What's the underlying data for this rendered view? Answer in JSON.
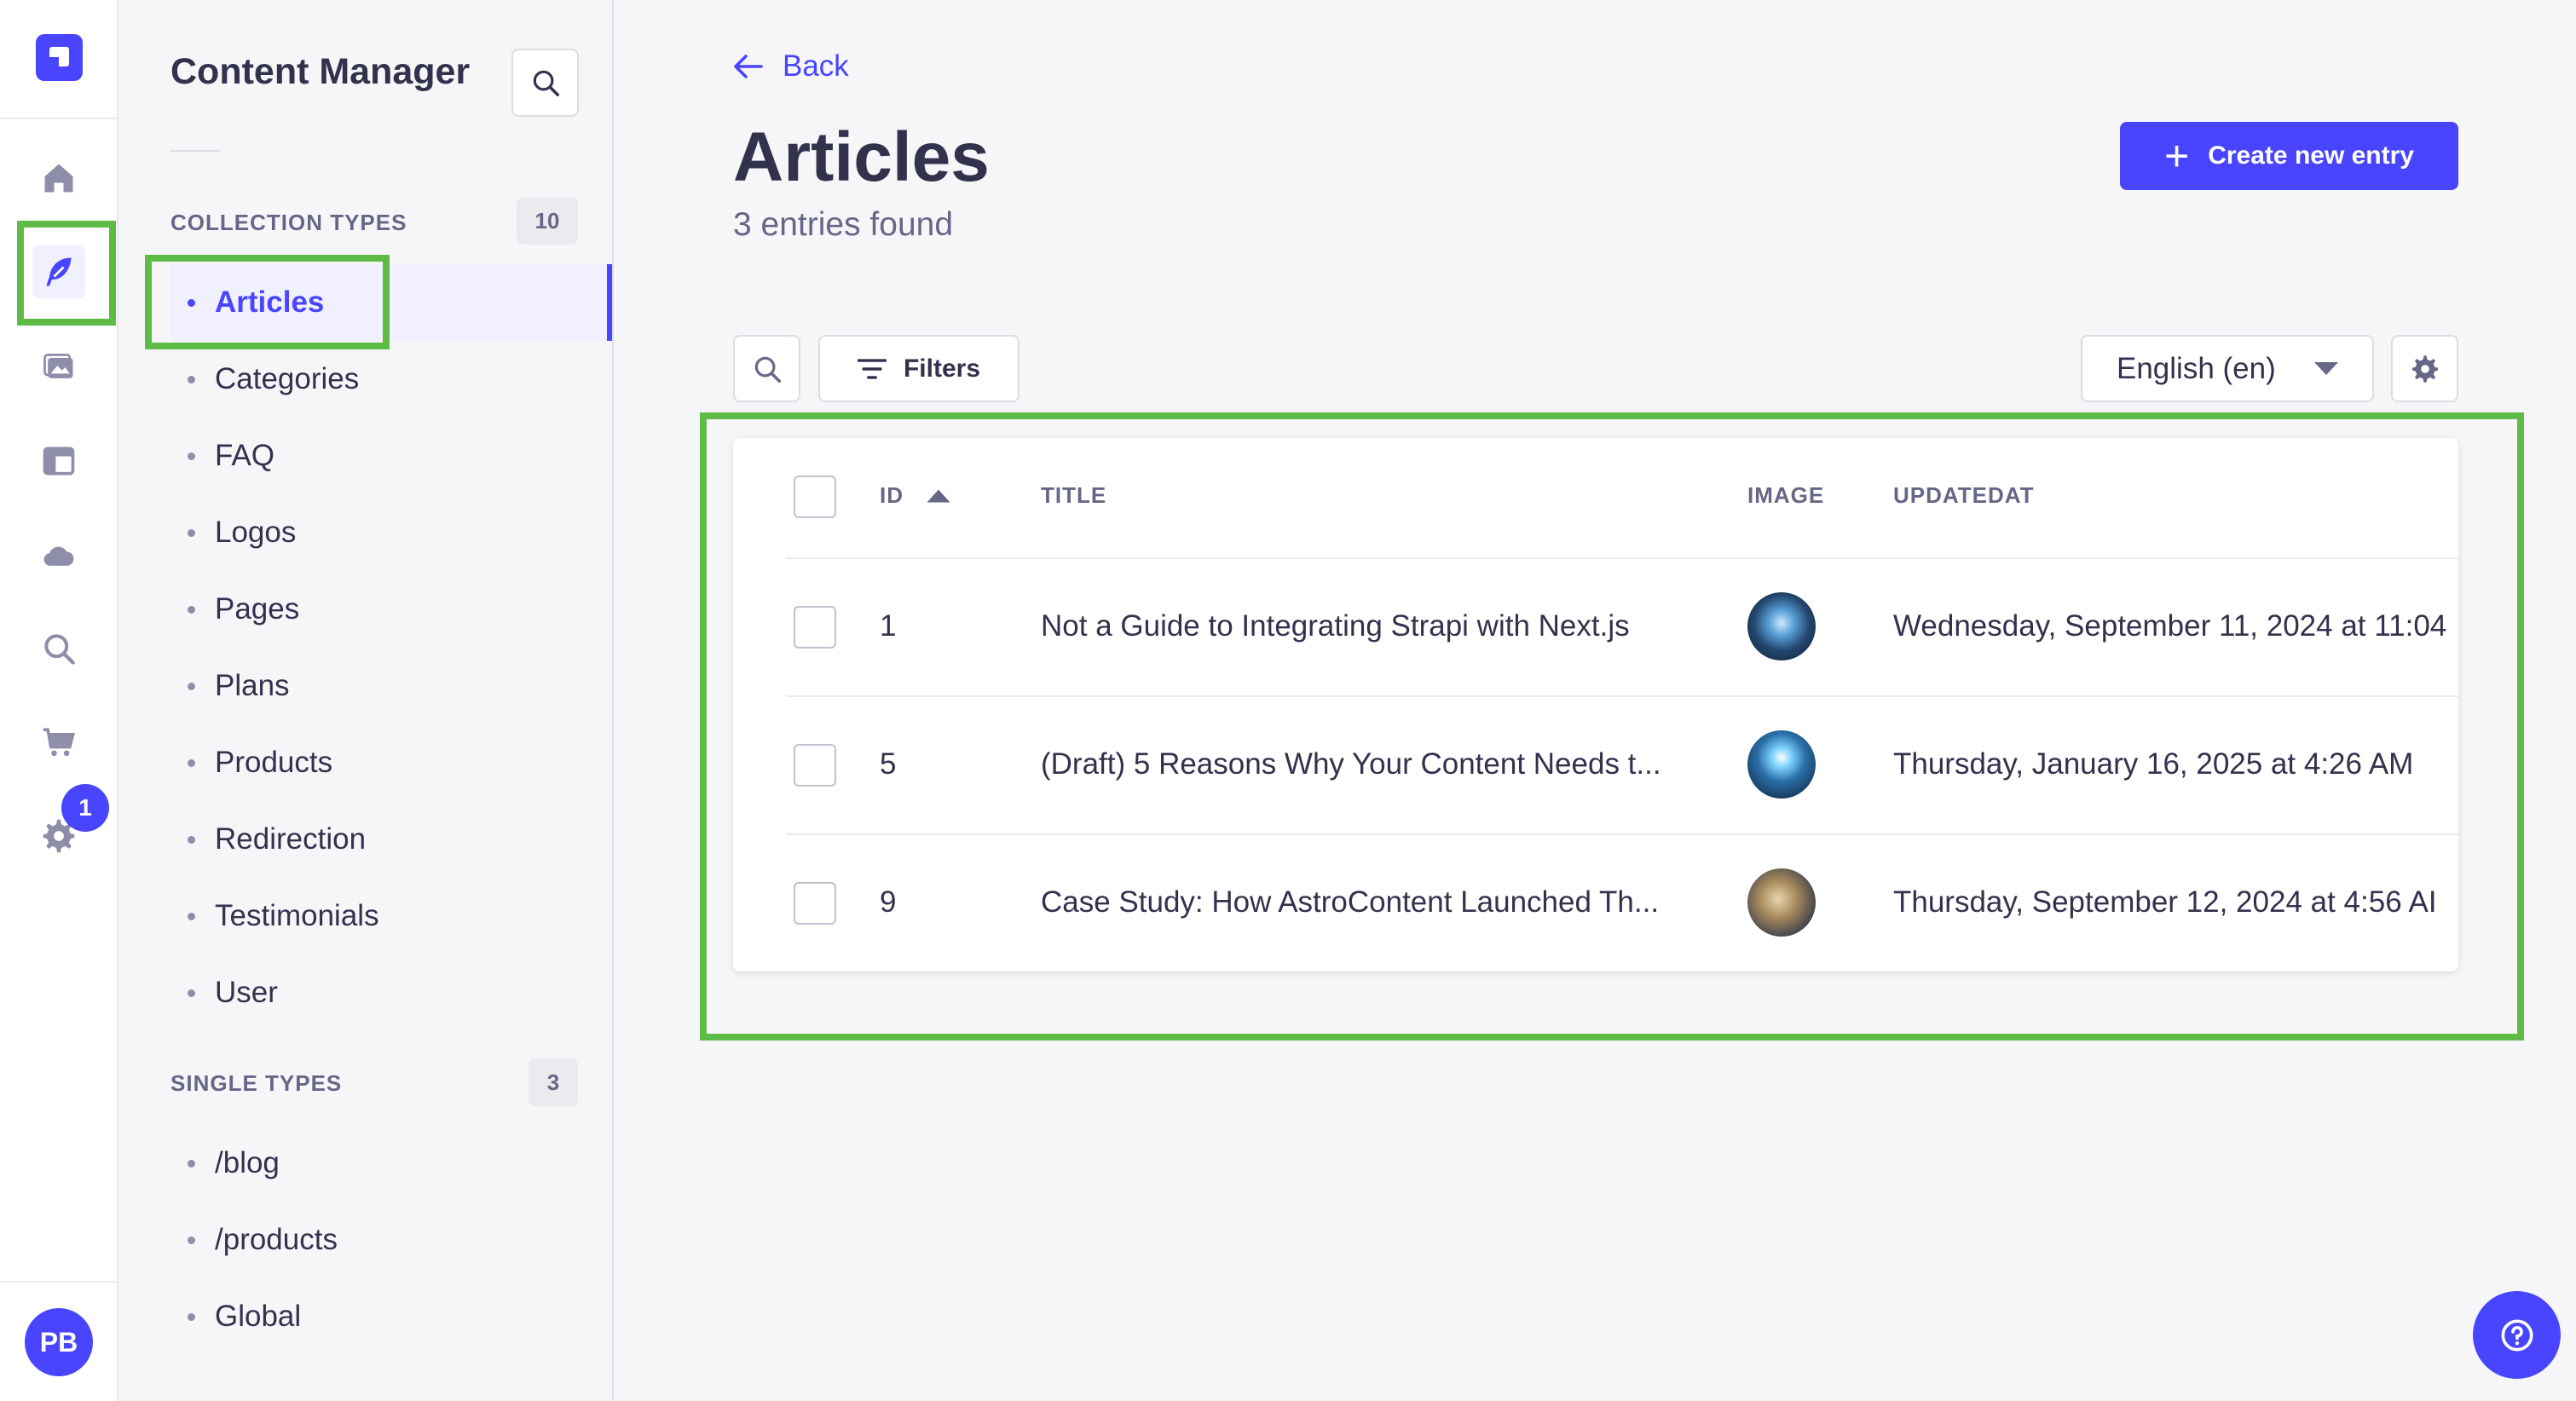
{
  "sidebar": {
    "title": "Content Manager",
    "collection_types_label": "COLLECTION TYPES",
    "collection_types_count": "10",
    "collection_types": [
      "Articles",
      "Categories",
      "FAQ",
      "Logos",
      "Pages",
      "Plans",
      "Products",
      "Redirection",
      "Testimonials",
      "User"
    ],
    "active_item": "Articles",
    "single_types_label": "SINGLE TYPES",
    "single_types_count": "3",
    "single_types": [
      "/blog",
      "/products",
      "Global"
    ]
  },
  "rail": {
    "icons": [
      "strapi-logo-icon",
      "home-icon",
      "content-manager-feather-icon",
      "media-library-icon",
      "content-type-builder-icon",
      "cloud-icon",
      "search-icon",
      "marketplace-cart-icon",
      "settings-gear-icon"
    ],
    "settings_badge": "1",
    "user_initials": "PB"
  },
  "header": {
    "back_label": "Back",
    "title": "Articles",
    "subtitle": "3 entries found",
    "create_label": "Create new entry"
  },
  "toolbar": {
    "filters_label": "Filters",
    "locale": "English (en)"
  },
  "table": {
    "columns": [
      "ID",
      "TITLE",
      "IMAGE",
      "UPDATEDAT"
    ],
    "sort_column": "ID",
    "sort_direction": "ascending",
    "rows": [
      {
        "id": "1",
        "title": "Not a Guide to Integrating Strapi with Next.js",
        "updated": "Wednesday, September 11, 2024 at 11:04"
      },
      {
        "id": "5",
        "title": "(Draft) 5 Reasons Why Your Content Needs t...",
        "updated": "Thursday, January 16, 2025 at 4:26 AM"
      },
      {
        "id": "9",
        "title": "Case Study: How AstroContent Launched Th...",
        "updated": "Thursday, September 12, 2024 at 4:56 AI"
      }
    ]
  },
  "colors": {
    "primary": "#4945ff",
    "highlight": "#5dbb46"
  }
}
